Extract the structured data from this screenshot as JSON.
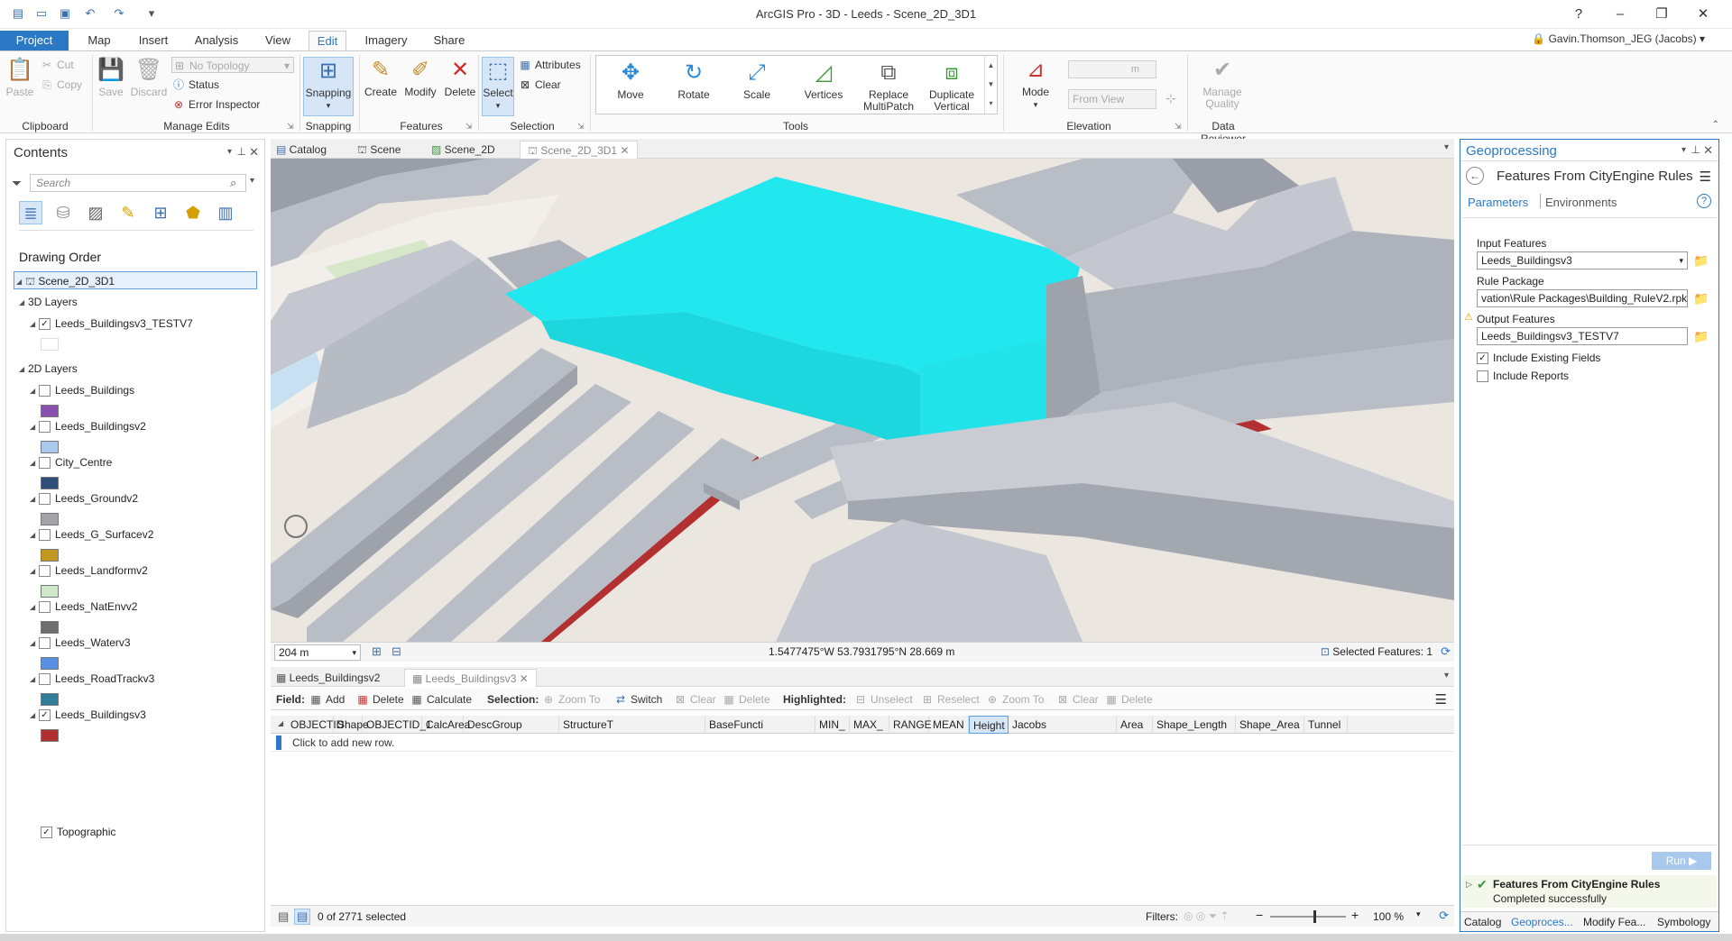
{
  "app": {
    "title": "ArcGIS Pro - 3D - Leeds - Scene_2D_3D1",
    "user": "Gavin.Thomson_JEG (Jacobs)",
    "help": "?"
  },
  "tabs": [
    "Project",
    "Map",
    "Insert",
    "Analysis",
    "View",
    "Edit",
    "Imagery",
    "Share"
  ],
  "ribbon": {
    "clipboard": {
      "label": "Clipboard",
      "paste": "Paste",
      "cut": "Cut",
      "copy": "Copy"
    },
    "manage_edits": {
      "label": "Manage Edits",
      "save": "Save",
      "discard": "Discard",
      "topology": "No Topology",
      "status": "Status",
      "error_inspector": "Error Inspector"
    },
    "snapping": {
      "label": "Snapping",
      "button": "Snapping"
    },
    "features": {
      "label": "Features",
      "create": "Create",
      "modify": "Modify",
      "delete": "Delete"
    },
    "selection": {
      "label": "Selection",
      "select": "Select",
      "attributes": "Attributes",
      "clear": "Clear"
    },
    "tools": {
      "label": "Tools",
      "move": "Move",
      "rotate": "Rotate",
      "scale": "Scale",
      "vertices": "Vertices",
      "replace1": "Replace",
      "replace2": "MultiPatch",
      "dup1": "Duplicate",
      "dup2": "Vertical"
    },
    "elevation": {
      "label": "Elevation",
      "mode": "Mode",
      "from_view": "From View",
      "unit": "m"
    },
    "data_reviewer": {
      "label": "Data Reviewer",
      "manage1": "Manage",
      "manage2": "Quality"
    }
  },
  "contents": {
    "title": "Contents",
    "search_placeholder": "Search",
    "drawing_order": "Drawing Order",
    "scene": "Scene_2D_3D1",
    "group3d": "3D Layers",
    "layer3d": "Leeds_Buildingsv3_TESTV7",
    "group2d": "2D Layers",
    "layers": [
      {
        "name": "Leeds_Buildings",
        "checked": false,
        "color": "#8a4fb0"
      },
      {
        "name": "Leeds_Buildingsv2",
        "checked": false,
        "color": "#a8c8ee"
      },
      {
        "name": "City_Centre",
        "checked": false,
        "color": "#2e4f7c"
      },
      {
        "name": "Leeds_Groundv2",
        "checked": false,
        "color": "#a3a3a8"
      },
      {
        "name": "Leeds_G_Surfacev2",
        "checked": false,
        "color": "#c2981f"
      },
      {
        "name": "Leeds_Landformv2",
        "checked": false,
        "color": "#cfe8c8"
      },
      {
        "name": "Leeds_NatEnvv2",
        "checked": false,
        "color": "#6e6e6e"
      },
      {
        "name": "Leeds_Waterv3",
        "checked": false,
        "color": "#5a8fe6"
      },
      {
        "name": "Leeds_RoadTrackv3",
        "checked": false,
        "color": "#2f7d96"
      },
      {
        "name": "Leeds_Buildingsv3",
        "checked": true,
        "color": "#b23030"
      }
    ],
    "topographic": "Topographic"
  },
  "view_tabs": [
    "Catalog",
    "Scene",
    "Scene_2D",
    "Scene_2D_3D1"
  ],
  "map": {
    "scale": "204 m",
    "coords": "1.5477475°W 53.7931795°N  28.669 m",
    "selected": "Selected Features: 1"
  },
  "table": {
    "tabs": [
      "Leeds_Buildingsv2",
      "Leeds_Buildingsv3"
    ],
    "toolbar": {
      "field": "Field:",
      "add": "Add",
      "delete": "Delete",
      "calculate": "Calculate",
      "selection": "Selection:",
      "zoom_to": "Zoom To",
      "switch": "Switch",
      "clear": "Clear",
      "delete2": "Delete",
      "highlighted": "Highlighted:",
      "unselect": "Unselect",
      "reselect": "Reselect",
      "zoom_to2": "Zoom To",
      "clear2": "Clear",
      "delete3": "Delete"
    },
    "columns": [
      "OBJECTID",
      "Shape",
      "OBJECTID_1",
      "CalcArea",
      "DescGroup",
      "StructureT",
      "BaseFuncti",
      "MIN_",
      "MAX_",
      "RANGE",
      "MEAN",
      "Height",
      "Jacobs",
      "Area",
      "Shape_Length",
      "Shape_Area",
      "Tunnel"
    ],
    "add_row": "Click to add new row.",
    "selected_count": "0 of 2771 selected",
    "filters": "Filters:",
    "zoom": "100 %"
  },
  "geoprocessing": {
    "title": "Geoprocessing",
    "tool": "Features From CityEngine Rules",
    "tab_params": "Parameters",
    "tab_env": "Environments",
    "input_label": "Input Features",
    "input_value": "Leeds_Buildingsv3",
    "rule_label": "Rule Package",
    "rule_value": "vation\\Rule Packages\\Building_RuleV2.rpk",
    "output_label": "Output Features",
    "output_value": "Leeds_Buildingsv3_TESTV7",
    "include_fields": "Include Existing Fields",
    "include_reports": "Include Reports",
    "run": "Run",
    "result_title": "Features From CityEngine Rules",
    "result_status": "Completed successfully",
    "bottom_tabs": [
      "Catalog",
      "Geoproces...",
      "Modify Fea...",
      "Symbology"
    ]
  }
}
